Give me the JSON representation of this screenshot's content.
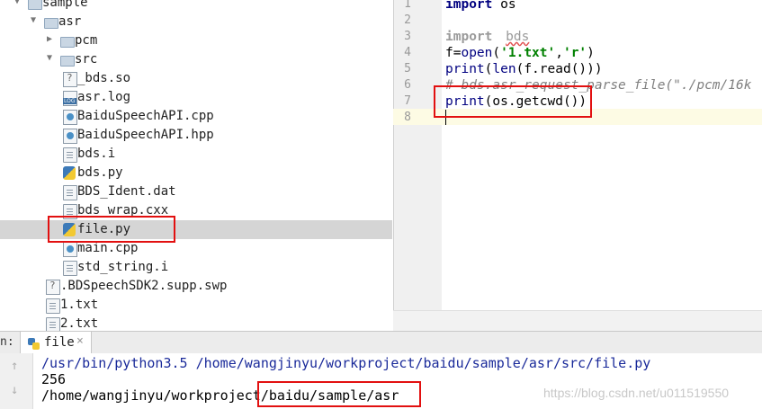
{
  "project_tree": {
    "items": [
      {
        "label": "sample",
        "indent": 0,
        "kind": "folder",
        "expanded": true
      },
      {
        "label": "asr",
        "indent": 1,
        "kind": "folder",
        "expanded": true
      },
      {
        "label": "pcm",
        "indent": 2,
        "kind": "folder",
        "expanded": false
      },
      {
        "label": "src",
        "indent": 2,
        "kind": "folder",
        "expanded": true
      },
      {
        "label": "_bds.so",
        "indent": 3,
        "kind": "so"
      },
      {
        "label": "asr.log",
        "indent": 3,
        "kind": "log"
      },
      {
        "label": "BaiduSpeechAPI.cpp",
        "indent": 3,
        "kind": "cpp"
      },
      {
        "label": "BaiduSpeechAPI.hpp",
        "indent": 3,
        "kind": "cpp"
      },
      {
        "label": "bds.i",
        "indent": 3,
        "kind": "doc"
      },
      {
        "label": "bds.py",
        "indent": 3,
        "kind": "py"
      },
      {
        "label": "BDS_Ident.dat",
        "indent": 3,
        "kind": "doc"
      },
      {
        "label": "bds_wrap.cxx",
        "indent": 3,
        "kind": "doc"
      },
      {
        "label": "file.py",
        "indent": 3,
        "kind": "py",
        "selected": true
      },
      {
        "label": "main.cpp",
        "indent": 3,
        "kind": "cpp"
      },
      {
        "label": "std_string.i",
        "indent": 3,
        "kind": "doc"
      },
      {
        "label": ".BDSpeechSDK2.supp.swp",
        "indent": 2,
        "kind": "so"
      },
      {
        "label": "1.txt",
        "indent": 2,
        "kind": "doc"
      },
      {
        "label": "2.txt",
        "indent": 2,
        "kind": "doc"
      }
    ]
  },
  "editor": {
    "line_numbers": [
      "1",
      "2",
      "3",
      "4",
      "5",
      "6",
      "7",
      "8"
    ],
    "line1_kw": "import",
    "line1_rest": " os",
    "line3_kw": "import",
    "line3_rest": "bds",
    "line4_a": "f=",
    "line4_fn": "open",
    "line4_b": "(",
    "line4_s1": "'1.txt'",
    "line4_c": ",",
    "line4_s2": "'r'",
    "line4_d": ")",
    "line5_fn1": "print",
    "line5_a": "(",
    "line5_fn2": "len",
    "line5_b": "(f.read()))",
    "line6": "# bds.asr_request_parse_file(\"./pcm/16k",
    "line7_fn": "print",
    "line7_rest": "(os.getcwd())"
  },
  "run_panel": {
    "tab_prefix": "n:",
    "tab_label": "file",
    "tab_close": "×",
    "output_lines": [
      "/usr/bin/python3.5 /home/wangjinyu/workproject/baidu/sample/asr/src/file.py",
      "256",
      "/home/wangjinyu/workproject/baidu/sample/asr"
    ],
    "watermark": "https://blog.csdn.net/u011519550"
  },
  "colors": {
    "highlight_box": "#e21010",
    "keyword": "#000080",
    "string": "#008000",
    "comment": "#808080"
  }
}
